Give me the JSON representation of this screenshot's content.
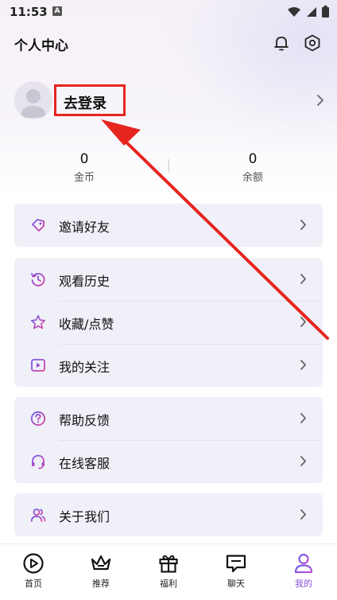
{
  "status_bar": {
    "time": "11:53",
    "notification_letter": "A"
  },
  "header": {
    "title": "个人中心"
  },
  "profile": {
    "login_label": "去登录"
  },
  "stats": [
    {
      "value": "0",
      "label": "金币"
    },
    {
      "value": "0",
      "label": "余额"
    }
  ],
  "menu": {
    "invite": "邀请好友",
    "history": "观看历史",
    "favorites": "收藏/点赞",
    "following": "我的关注",
    "feedback": "帮助反馈",
    "service": "在线客服",
    "about": "关于我们"
  },
  "tabs": [
    {
      "label": "首页"
    },
    {
      "label": "推荐"
    },
    {
      "label": "福利"
    },
    {
      "label": "聊天"
    },
    {
      "label": "我的"
    }
  ],
  "colors": {
    "accent": "#8b4fd8",
    "annotation": "#e6251f",
    "card": "#f0f0f8"
  }
}
